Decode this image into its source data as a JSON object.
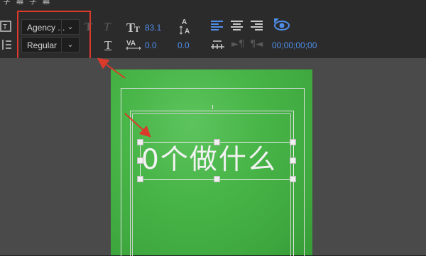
{
  "title_strip": "字 幕 字 幕",
  "font": {
    "family": "Agency ...",
    "style": "Regular"
  },
  "font_size": "83.1",
  "tracking": "0.0",
  "leading": "0.0",
  "timecode": "00;00;00;00",
  "canvas_text": "0个做什么",
  "colors": {
    "accent": "#4f8ee8",
    "highlight": "#d93a2b",
    "greenscreen": "#48b548"
  },
  "icons": [
    "text-tool-icon",
    "vertical-text-icon",
    "italic-icon",
    "faux-italic-icon",
    "font-size-icon",
    "underline-icon",
    "kerning-icon",
    "leading-icon",
    "align-left-icon",
    "align-center-icon",
    "align-right-icon",
    "tab-icon",
    "indent-icon",
    "paragraph-icon",
    "visibility-icon"
  ]
}
